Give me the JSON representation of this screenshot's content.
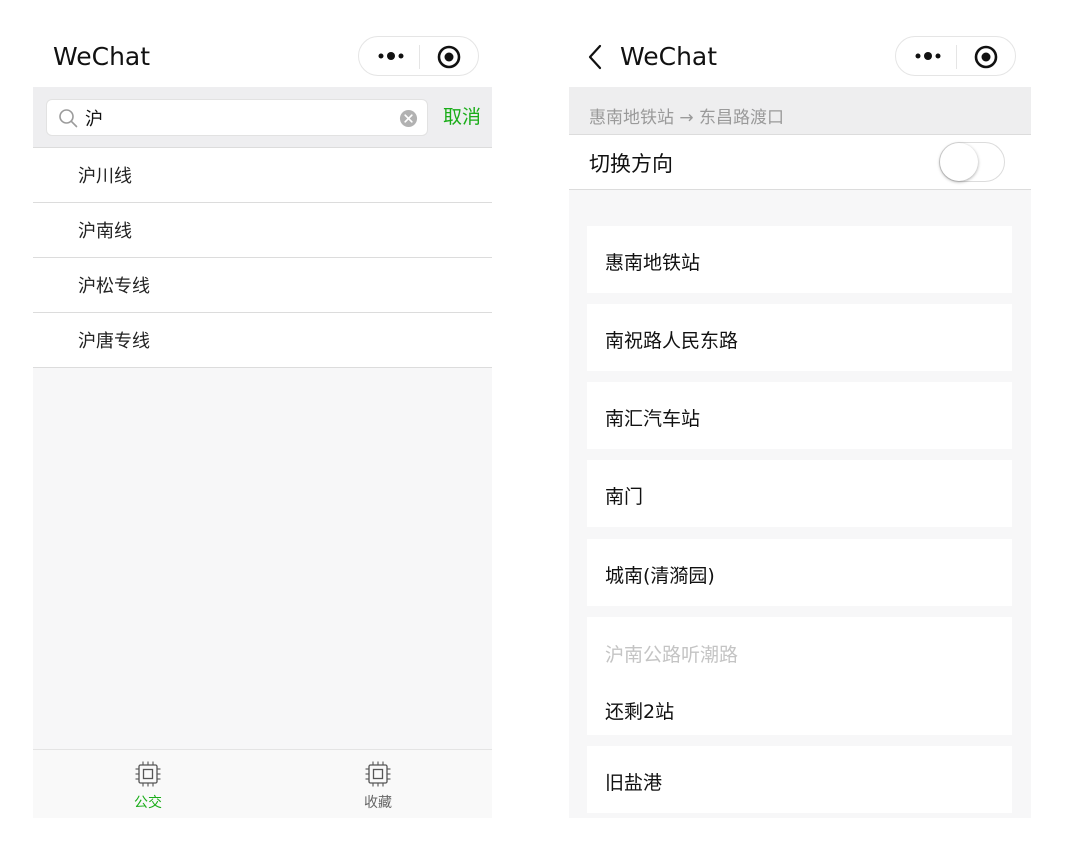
{
  "left": {
    "nav": {
      "title": "WeChat"
    },
    "search": {
      "value": "沪",
      "cancel_label": "取消"
    },
    "results": [
      {
        "label": "沪川线"
      },
      {
        "label": "沪南线"
      },
      {
        "label": "沪松专线"
      },
      {
        "label": "沪唐专线"
      }
    ],
    "tabs": [
      {
        "label": "公交",
        "active": true
      },
      {
        "label": "收藏",
        "active": false
      }
    ]
  },
  "right": {
    "nav": {
      "title": "WeChat"
    },
    "route": "惠南地铁站 → 东昌路渡口",
    "switch_direction": {
      "label": "切换方向",
      "on": false
    },
    "stations": [
      {
        "name": "惠南地铁站"
      },
      {
        "name": "南祝路人民东路"
      },
      {
        "name": "南汇汽车站"
      },
      {
        "name": "南门"
      },
      {
        "name": "城南(清漪园)"
      },
      {
        "name": "沪南公路听潮路",
        "remaining": "还剩2站"
      },
      {
        "name": "旧盐港"
      }
    ]
  },
  "colors": {
    "accent_green": "#1aad19",
    "muted_text": "#9a9a9a",
    "page_gray": "#f7f7f8"
  }
}
